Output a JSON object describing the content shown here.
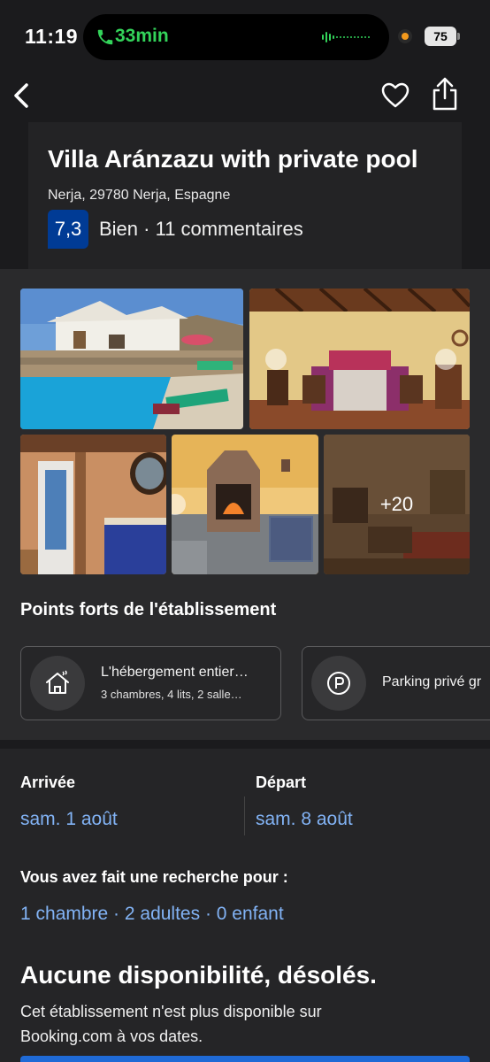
{
  "status_bar": {
    "time": "11:19",
    "call_duration": "33min",
    "battery": "75",
    "call_color": "#33d35a"
  },
  "nav": {
    "back_icon": "chevron-left-icon",
    "favorite_icon": "heart-icon",
    "share_icon": "share-icon"
  },
  "property": {
    "title": "Villa Aránzazu with private pool",
    "address": "Nerja, 29780 Nerja, Espagne",
    "score": "7,3",
    "rating_word": "Bien",
    "separator": " · ",
    "reviews": "11 commentaires",
    "score_color": "#003b95"
  },
  "photos": {
    "more_count": "+20"
  },
  "highlights": {
    "title": "Points forts de l'établissement",
    "items": [
      {
        "icon": "house-icon",
        "title": "L'hébergement entier…",
        "subtitle": "3 chambres, 4 lits, 2 salle…"
      },
      {
        "icon": "parking-icon",
        "title": "Parking privé gr",
        "subtitle": ""
      }
    ]
  },
  "dates": {
    "checkin_label": "Arrivée",
    "checkin_value": "sam. 1 août",
    "checkout_label": "Départ",
    "checkout_value": "sam. 8 août",
    "accent_color": "#82b3f5"
  },
  "search": {
    "label": "Vous avez fait une recherche pour :",
    "value": "1 chambre · 2 adultes · 0 enfant"
  },
  "availability": {
    "title": "Aucune disponibilité, désolés.",
    "text": "Cet établissement n'est plus disponible sur Booking.com à vos dates."
  }
}
